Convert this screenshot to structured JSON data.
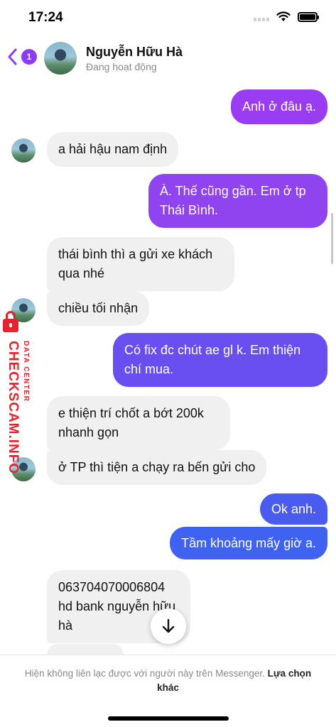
{
  "status_bar": {
    "time": "17:24"
  },
  "header": {
    "unread_count": "1",
    "contact_name": "Nguyễn Hữu Hà",
    "status": "Đang hoạt động"
  },
  "messages": [
    {
      "from": "me",
      "text": "Anh ở đâu ạ."
    },
    {
      "from": "them",
      "text": "a hải hậu nam định"
    },
    {
      "from": "me",
      "text": "À. Thế cũng gần. Em ở tp Thái Bình."
    },
    {
      "from": "them",
      "text": "thái bình thì a gửi xe khách qua nhé"
    },
    {
      "from": "them",
      "text": "chiều tối nhận"
    },
    {
      "from": "me",
      "text": "Có fix đc chút ae gl k. Em thiện chí mua."
    },
    {
      "from": "them",
      "text": "e thiện trí chốt a bớt 200k nhanh gọn"
    },
    {
      "from": "them",
      "text": "ở TP thì tiện a chạy ra bến gửi cho"
    },
    {
      "from": "me",
      "text": "Ok anh."
    },
    {
      "from": "me",
      "text": "Tầm khoảng mấy giờ a."
    },
    {
      "from": "them",
      "text": "063704070006804 hd bank nguyễn hữu hà"
    }
  ],
  "watermark": {
    "main": "CHECKSCAM.INFO",
    "sub": "DATA CENTER"
  },
  "footer": {
    "notice": "Hiện không liên lạc được với người này trên Messenger.",
    "link": "Lựa chọn khác"
  },
  "colors": {
    "accent": "#8b3cf7",
    "out_bubble_top": "#9b3af2",
    "out_bubble_bottom": "#3d63f0",
    "watermark": "#e8222c"
  }
}
